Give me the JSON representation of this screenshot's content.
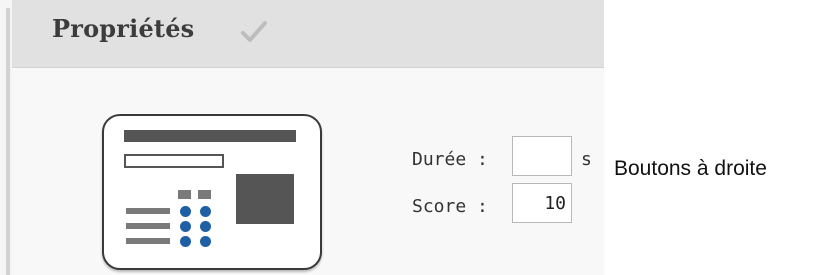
{
  "properties": {
    "title": "Propriétés",
    "status_icon": "check-icon"
  },
  "form": {
    "duration_label": "Durée :",
    "duration_value": "",
    "duration_unit": "s",
    "score_label": "Score :",
    "score_value": "10"
  },
  "template_icon": "buttons-right-template-icon",
  "caption": "Boutons à droite",
  "colors": {
    "header_bg": "#e1e1e1",
    "body_bg": "#f8f8f8",
    "dot_blue": "#1f5fa5"
  }
}
